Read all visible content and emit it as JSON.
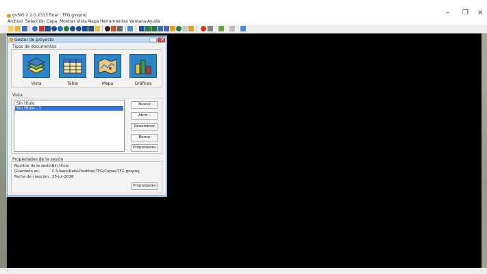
{
  "window": {
    "title": "gvSIG 2.2.0.2313 final : TFG.gvsproj",
    "controls": {
      "minimize": "–",
      "restore": "❐",
      "close": "×"
    }
  },
  "menubar": {
    "items": [
      "Archivo",
      "Selección",
      "Capa",
      "Mostrar",
      "Vista",
      "Mapa",
      "Herramientas",
      "Ventana",
      "Ayuda"
    ]
  },
  "toolbar": {
    "icons": [
      "new-project-icon",
      "open-icon",
      "save-icon",
      "info-icon",
      "clear-selection-icon",
      "zoom-in-icon",
      "zoom-out-icon",
      "zoom-layer-icon",
      "zoom-all-icon",
      "zoom-previous-icon",
      "zoom-select-icon",
      "pan-icon",
      "select-icon",
      "query-icon",
      "measure-icon",
      "edit-icon",
      "add-layer-icon",
      "select-rect-icon",
      "select-poly-icon",
      "select-circle-icon",
      "select-buffer-icon",
      "select-attribute-icon",
      "filter-icon",
      "hyperlink-icon",
      "stop-icon",
      "edit-tools-icon",
      "grid-icon",
      "locator-icon"
    ]
  },
  "project_manager": {
    "title": "Gestor de proyecto",
    "doc_types_label": "Tipos de documentos",
    "doc_types": [
      {
        "label": "Vista",
        "icon": "view-layers-icon"
      },
      {
        "label": "Tabla",
        "icon": "table-icon"
      },
      {
        "label": "Mapa",
        "icon": "map-icon"
      },
      {
        "label": "Gráficas",
        "icon": "charts-icon"
      }
    ],
    "list_group_label": "Vista",
    "list_items": [
      "Sin título",
      "Sin título - 1"
    ],
    "selected_index": 1,
    "buttons": {
      "new": "Nuevo",
      "open": "Abrir...",
      "rename": "Renombrar",
      "delete": "Borrar",
      "properties": "Propiedades"
    },
    "session": {
      "label": "Propiedades de la sesión",
      "name_key": "Nombre de la sesión:",
      "name_val": "Sin título",
      "saved_key": "Guardado en:",
      "saved_val": "C:\\Users\\Rafa\\Desktop\\TFG\\Capas\\TFG.gvsproj",
      "date_key": "Fecha de creación:",
      "date_val": "25-jul-2016",
      "properties_button": "Propiedades"
    }
  },
  "scrollbar": {
    "left": "‹",
    "right": "›"
  }
}
